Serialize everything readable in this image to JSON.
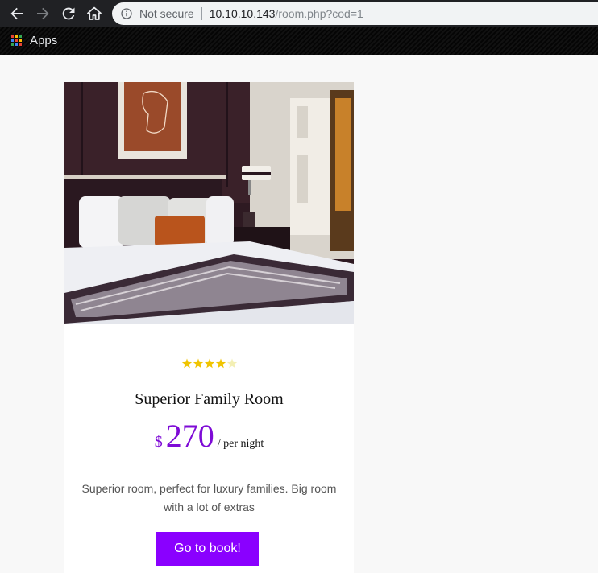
{
  "browser": {
    "security_label": "Not secure",
    "url_host": "10.10.10.143",
    "url_path": "/room.php?cod=1",
    "bookmarks": {
      "apps_label": "Apps"
    },
    "icons": [
      "back-icon",
      "forward-icon",
      "reload-icon",
      "home-icon",
      "info-icon",
      "apps-grid-icon"
    ]
  },
  "room": {
    "rating": 4,
    "rating_max": 5,
    "name": "Superior Family Room",
    "currency": "$",
    "price": "270",
    "price_unit": "/ per night",
    "description": "Superior room, perfect for luxury families. Big room with a lot of extras",
    "book_label": "Go to book!"
  },
  "colors": {
    "accent": "#8a00ff",
    "price": "#7e0bd6",
    "star_filled": "#f0c400",
    "star_empty": "#f3efb4"
  }
}
